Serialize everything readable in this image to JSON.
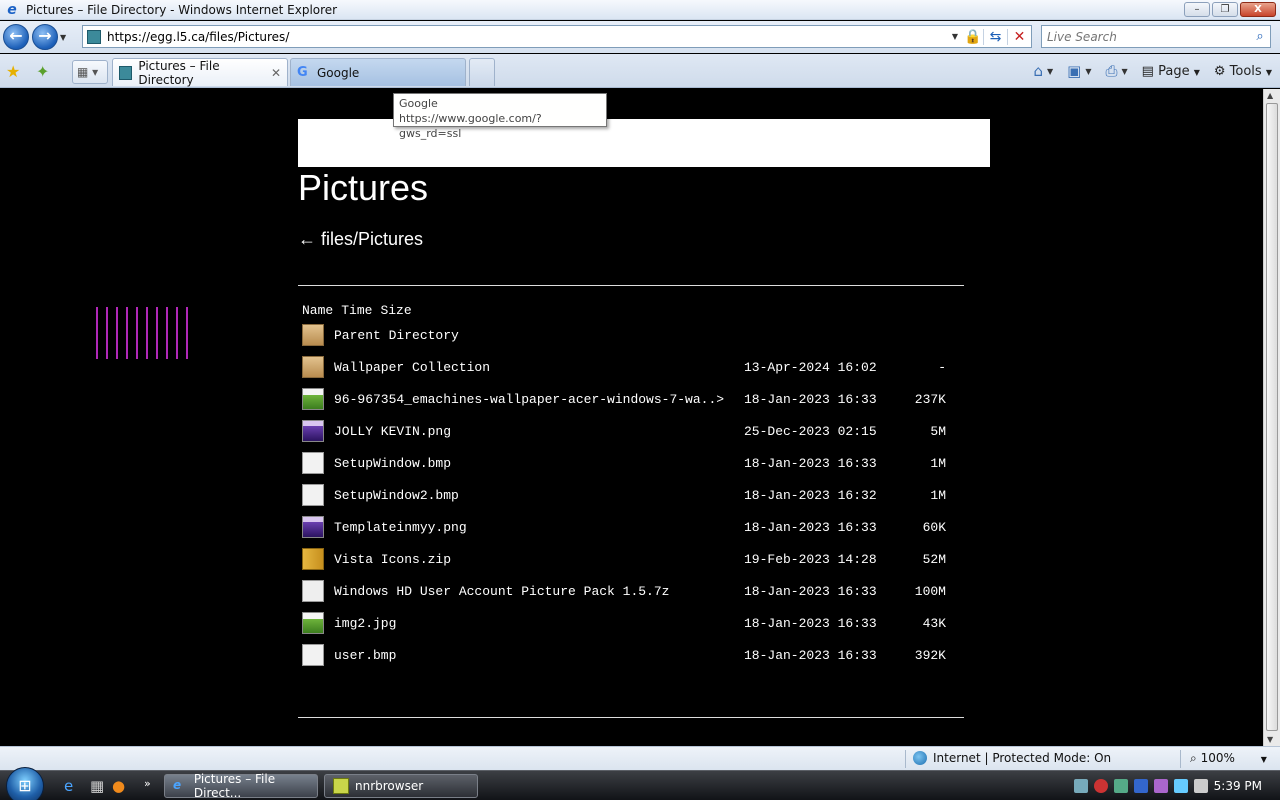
{
  "window": {
    "title": "Pictures – File Directory - Windows Internet Explorer",
    "minimize": "–",
    "maximize": "❐",
    "close": "X"
  },
  "address_bar": {
    "url": "https://egg.l5.ca/files/Pictures/",
    "search_placeholder": "Live Search"
  },
  "tabs": [
    {
      "label": "Pictures – File Directory",
      "active": true
    },
    {
      "label": "Google",
      "active": false
    }
  ],
  "command_bar": {
    "page_label": "Page",
    "tools_label": "Tools"
  },
  "tooltip": {
    "title": "Google",
    "url": "https://www.google.com/?gws_rd=ssl"
  },
  "page": {
    "heading": "Pictures",
    "back_link": "← files/Pictures",
    "columns": {
      "name": "Name",
      "time": "Time",
      "size": "Size"
    },
    "entries": [
      {
        "name": "Parent Directory",
        "date": "",
        "size": "",
        "icon": "folder"
      },
      {
        "name": "Wallpaper Collection",
        "date": "13-Apr-2024 16:02",
        "size": "-",
        "icon": "folder"
      },
      {
        "name": "96-967354_emachines-wallpaper-acer-windows-7-wa..>",
        "date": "18-Jan-2023 16:33",
        "size": "237K",
        "icon": "image-green"
      },
      {
        "name": "JOLLY KEVIN.png",
        "date": "25-Dec-2023 02:15",
        "size": "5M",
        "icon": "image-purple"
      },
      {
        "name": "SetupWindow.bmp",
        "date": "18-Jan-2023 16:33",
        "size": "1M",
        "icon": "blank"
      },
      {
        "name": "SetupWindow2.bmp",
        "date": "18-Jan-2023 16:32",
        "size": "1M",
        "icon": "blank"
      },
      {
        "name": "Templateinmyy.png",
        "date": "18-Jan-2023 16:33",
        "size": "60K",
        "icon": "image-purple"
      },
      {
        "name": "Vista Icons.zip",
        "date": "19-Feb-2023 14:28",
        "size": "52M",
        "icon": "zip"
      },
      {
        "name": "Windows HD User Account Picture Pack 1.5.7z",
        "date": "18-Jan-2023 16:33",
        "size": "100M",
        "icon": "archive"
      },
      {
        "name": "img2.jpg",
        "date": "18-Jan-2023 16:33",
        "size": "43K",
        "icon": "image-green"
      },
      {
        "name": "user.bmp",
        "date": "18-Jan-2023 16:33",
        "size": "392K",
        "icon": "blank"
      }
    ]
  },
  "status_bar": {
    "zone": "Internet | Protected Mode: On",
    "zoom": "100%"
  },
  "taskbar": {
    "items": [
      {
        "label": "Pictures – File Direct...",
        "active": true
      },
      {
        "label": "nnrbrowser",
        "active": false
      }
    ],
    "clock": "5:39 PM"
  }
}
